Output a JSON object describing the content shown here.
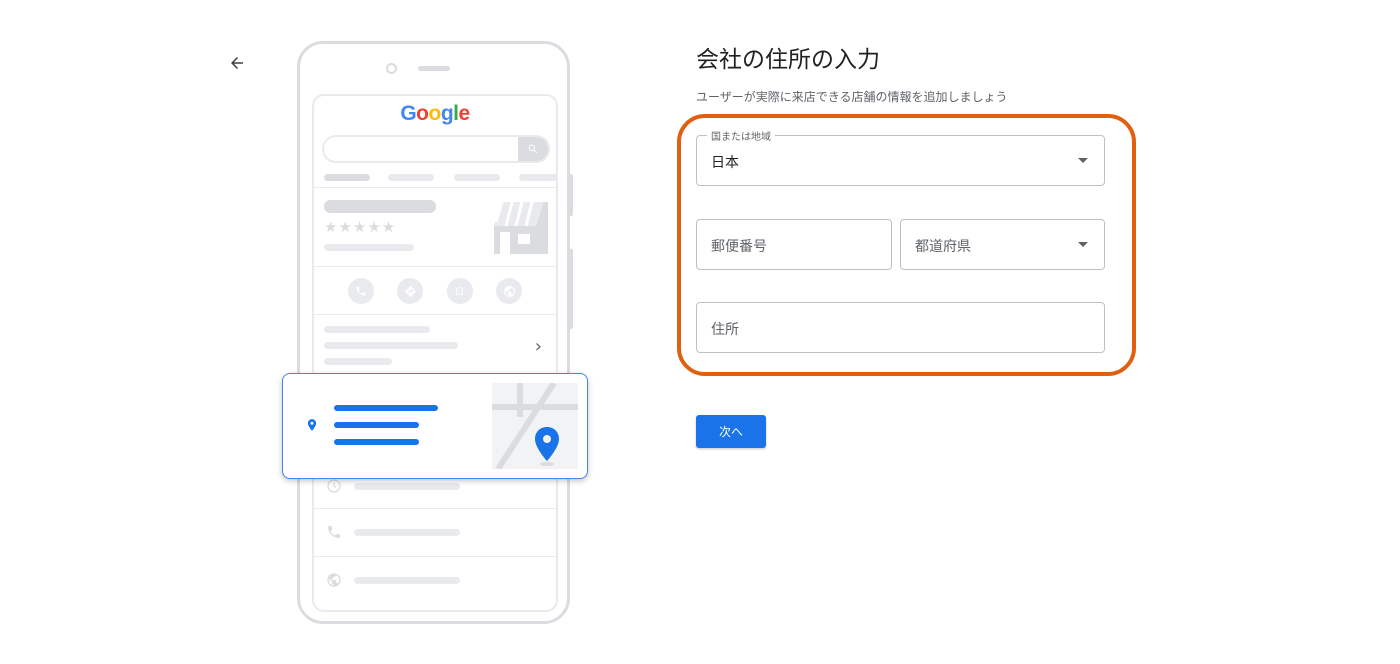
{
  "page": {
    "title": "会社の住所の入力",
    "subtitle": "ユーザーが実際に来店できる店舗の情報を追加しましょう"
  },
  "illustration": {
    "logo_text": "Google",
    "stars": "★★★★★"
  },
  "form": {
    "country": {
      "label": "国または地域",
      "value": "日本"
    },
    "postal_code": {
      "placeholder": "郵便番号"
    },
    "prefecture": {
      "placeholder": "都道府県"
    },
    "address": {
      "placeholder": "住所"
    }
  },
  "actions": {
    "next_label": "次へ"
  },
  "colors": {
    "highlight": "#e0600f",
    "primary": "#1a73e8",
    "border": "#bdc1c6"
  }
}
